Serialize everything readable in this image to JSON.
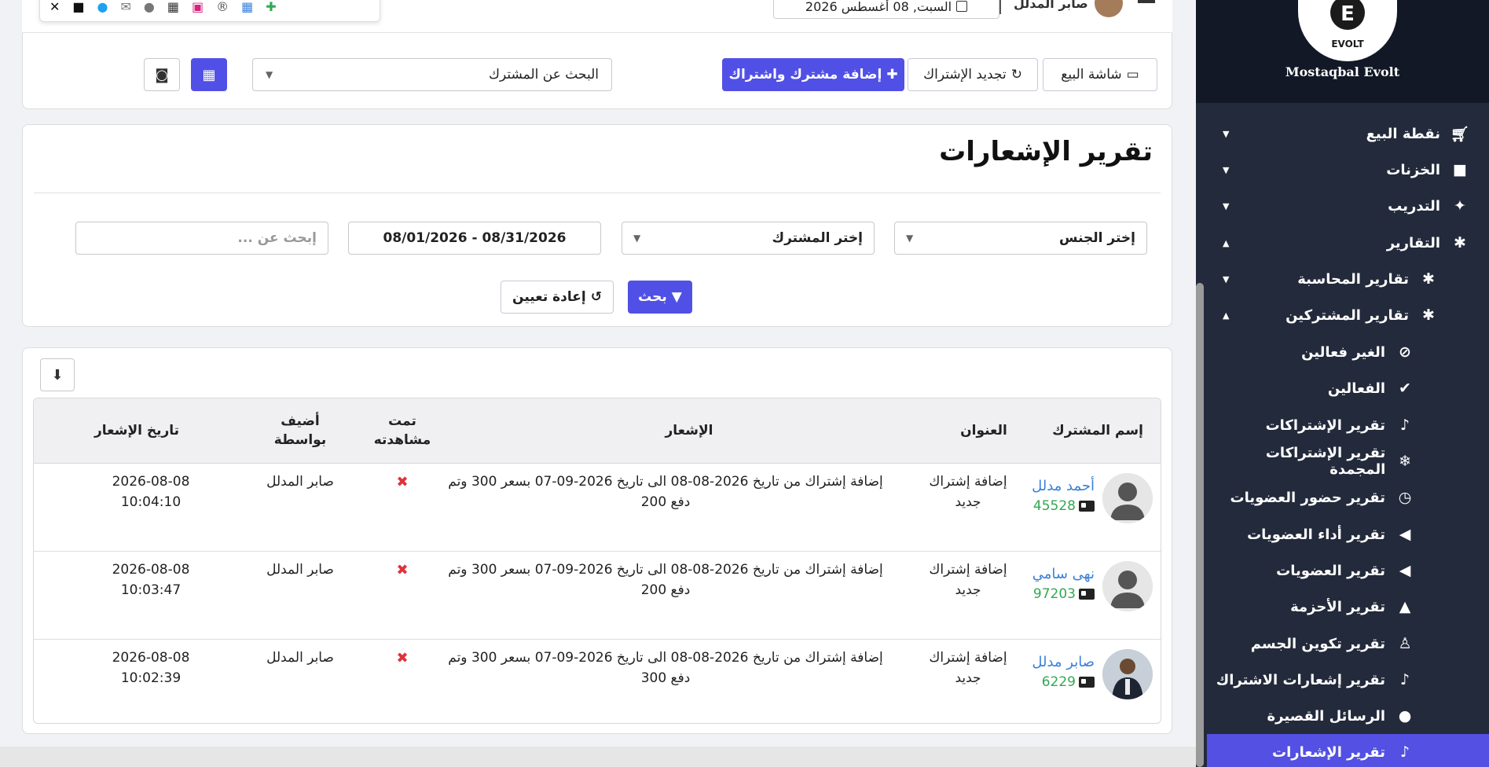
{
  "top_header": {
    "date": "السبت, 08 أغسطس 2026",
    "user_name": "صابر المدلل"
  },
  "floating_toolbar": {
    "icons": [
      "close-icon",
      "square-icon",
      "twitter-icon",
      "mail-icon",
      "chat-icon",
      "qr-icon",
      "camera-icon",
      "registered-icon",
      "grid-icon",
      "user-plus-icon"
    ]
  },
  "actions": {
    "pos_screen": "شاشة البيع",
    "renew": "تجديد الإشتراك",
    "add_member": "إضافة مشترك واشتراك",
    "search_member_placeholder": "البحث عن المشترك"
  },
  "page": {
    "title": "تقرير الإشعارات"
  },
  "filters": {
    "gender": "إختر الجنس",
    "member": "إختر المشترك",
    "date_range": "08/01/2026 - 08/31/2026",
    "search_placeholder": "إبحث عن ...",
    "search_button": "بحث",
    "reset_button": "إعادة تعيين"
  },
  "table": {
    "headers": {
      "member": "إسم المشترك",
      "title": "العنوان",
      "notification": "الإشعار",
      "seen": "تمت مشاهدته",
      "added_by": "أضيف بواسطة",
      "date": "تاريخ الإشعار"
    },
    "rows": [
      {
        "name": "أحمد مدلل",
        "id": "45528",
        "title": "إضافة إشتراك جديد",
        "notification": "إضافة إشتراك من تاريخ 2026-08-08 الى تاريخ 2026-09-07 بسعر 300 وتم دفع 200",
        "seen": "✖",
        "added_by": "صابر المدلل",
        "date": "2026-08-08",
        "time": "10:04:10"
      },
      {
        "name": "نهى سامي",
        "id": "97203",
        "title": "إضافة إشتراك جديد",
        "notification": "إضافة إشتراك من تاريخ 2026-08-08 الى تاريخ 2026-09-07 بسعر 300 وتم دفع 200",
        "seen": "✖",
        "added_by": "صابر المدلل",
        "date": "2026-08-08",
        "time": "10:03:47"
      },
      {
        "name": "صابر مدلل",
        "id": "6229",
        "title": "إضافة إشتراك جديد",
        "notification": "إضافة إشتراك من تاريخ 2026-08-08 الى تاريخ 2026-09-07 بسعر 300 وتم دفع 300",
        "seen": "✖",
        "added_by": "صابر المدلل",
        "date": "2026-08-08",
        "time": "10:02:39"
      }
    ]
  },
  "sidebar": {
    "brand": "Mostaqbal Evolt",
    "logo_text": "EVOLT",
    "items": [
      {
        "label": "نقطة البيع",
        "icon": "cart-icon",
        "caret": "▼"
      },
      {
        "label": "الخزنات",
        "icon": "lock-icon",
        "caret": "▼"
      },
      {
        "label": "التدريب",
        "icon": "wand-icon",
        "caret": "▼"
      },
      {
        "label": "التقارير",
        "icon": "bug-icon",
        "caret": "▲"
      },
      {
        "label": "تقارير المحاسبة",
        "icon": "bug-icon",
        "caret": "▼"
      },
      {
        "label": "تقارير المشتركين",
        "icon": "bug-icon",
        "caret": "▲"
      },
      {
        "label": "الغير فعالين",
        "icon": "ban-icon",
        "caret": ""
      },
      {
        "label": "الفعالين",
        "icon": "check-icon",
        "caret": ""
      },
      {
        "label": "تقرير الإشتراكات",
        "icon": "bell-icon",
        "caret": ""
      },
      {
        "label": "تقرير الإشتراكات المجمدة",
        "icon": "snowflake-icon",
        "caret": ""
      },
      {
        "label": "تقرير حضور العضويات",
        "icon": "clock-icon",
        "caret": ""
      },
      {
        "label": "تقرير أداء العضويات",
        "icon": "megaphone-icon",
        "caret": ""
      },
      {
        "label": "تقرير العضويات",
        "icon": "megaphone-icon",
        "caret": ""
      },
      {
        "label": "تقرير الأحزمة",
        "icon": "graduation-cap-icon",
        "caret": ""
      },
      {
        "label": "تقرير تكوين الجسم",
        "icon": "child-icon",
        "caret": ""
      },
      {
        "label": "تقرير إشعارات الاشتراك",
        "icon": "bell-icon",
        "caret": ""
      },
      {
        "label": "الرسائل القصيرة",
        "icon": "comment-icon",
        "caret": ""
      },
      {
        "label": "تقرير الإشعارات",
        "icon": "bell-icon",
        "caret": "",
        "active": true
      }
    ]
  },
  "colors": {
    "primary": "#5150e6",
    "sidebar_bg": "#232a3b",
    "sidebar_top": "#121826",
    "link": "#3b7fd8",
    "member_id": "#34a853",
    "danger": "#e0313a"
  }
}
